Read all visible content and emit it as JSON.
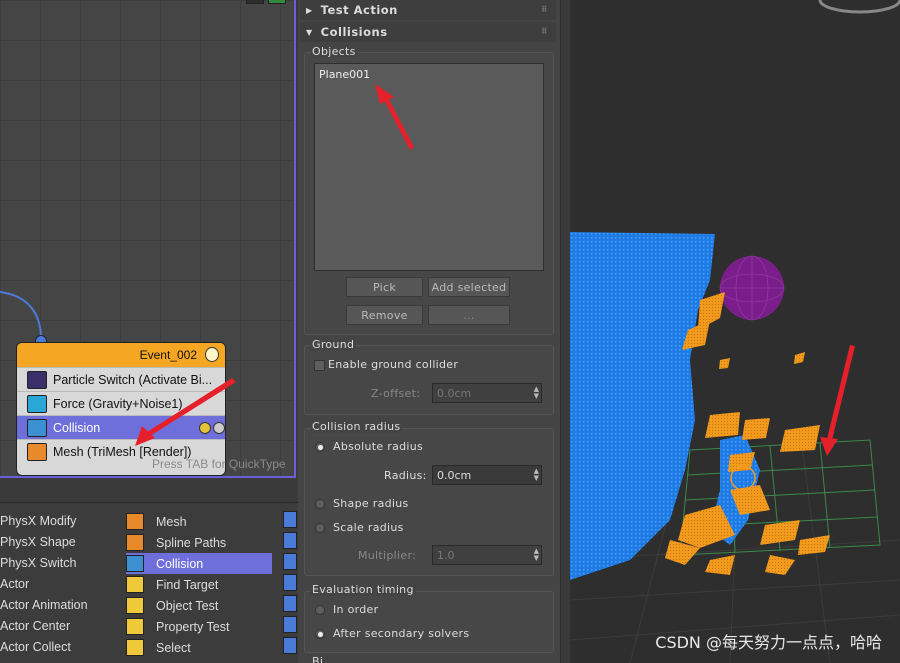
{
  "graph": {
    "event": {
      "title": "Event_002",
      "operators": [
        {
          "label": "Particle Switch (Activate Bi...",
          "icon": "particle-switch-icon"
        },
        {
          "label": "Force (Gravity+Noise1)",
          "icon": "force-icon"
        },
        {
          "label": "Collision",
          "icon": "collision-icon",
          "selected": true
        },
        {
          "label": "Mesh (TriMesh [Render])",
          "icon": "mesh-icon"
        }
      ]
    },
    "hint": "Press TAB for QuickType"
  },
  "depot": {
    "col1": [
      "PhysX Modify",
      "PhysX Shape",
      "PhysX Switch",
      "Actor",
      "Actor Animation",
      "Actor Center",
      "Actor Collect"
    ],
    "col2": [
      {
        "label": "Mesh",
        "color": "orange"
      },
      {
        "label": "Spline Paths",
        "color": "orange"
      },
      {
        "label": "Collision",
        "color": "blue",
        "selected": true
      },
      {
        "label": "Find Target",
        "color": "yellow"
      },
      {
        "label": "Object Test",
        "color": "yellow"
      },
      {
        "label": "Property Test",
        "color": "yellow"
      },
      {
        "label": "Select",
        "color": "yellow"
      }
    ]
  },
  "panel": {
    "rollout_test": "Test Action",
    "rollout_collisions": "Collisions",
    "objects_label": "Objects",
    "objects": [
      "Plane001"
    ],
    "pick": "Pick",
    "add_selected": "Add selected",
    "remove": "Remove",
    "more": "...",
    "ground_label": "Ground",
    "enable_ground": "Enable ground collider",
    "zoffset_label": "Z-offset:",
    "zoffset_value": "0.0cm",
    "radius_group": "Collision radius",
    "absolute_radius": "Absolute radius",
    "radius_label": "Radius:",
    "radius_value": "0.0cm",
    "shape_radius": "Shape radius",
    "scale_radius": "Scale radius",
    "multiplier_label": "Multiplier:",
    "multiplier_value": "1.0",
    "eval_group": "Evaluation timing",
    "in_order": "In order",
    "after_solvers": "After secondary solvers",
    "next_group": "Bi..."
  },
  "viewport": {
    "watermark": "CSDN @每天努力一点点，哈哈",
    "colors": {
      "particles_blue": "#1e7be6",
      "particles_orange": "#f29a1c",
      "sphere": "#7a1f8a",
      "grid": "#3a8a4a"
    }
  },
  "colors": {
    "selection": "#6f6fdc",
    "event_header": "#f5a623",
    "annotation_arrow": "#e6202a"
  }
}
